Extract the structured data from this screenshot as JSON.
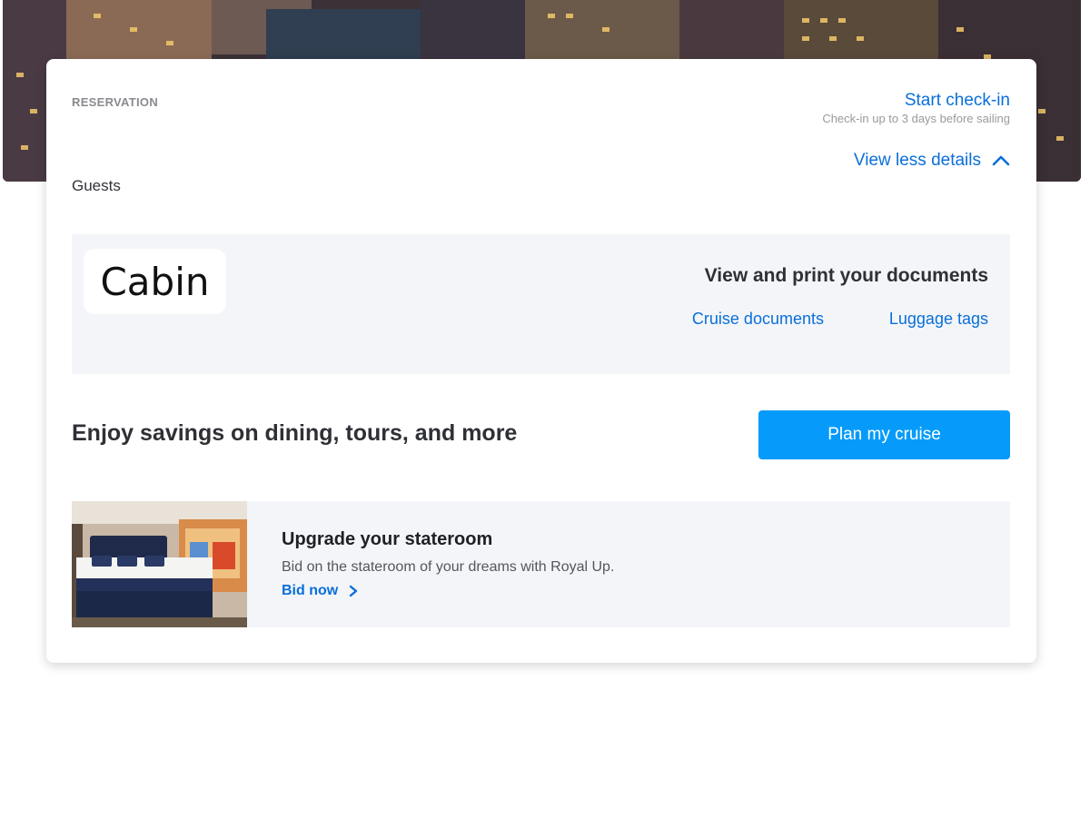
{
  "hero": {
    "image": "city-skyline-night"
  },
  "reservation": {
    "label": "RESERVATION",
    "checkin_link": "Start check-in",
    "checkin_note": "Check-in up to 3 days before sailing",
    "view_less": "View less details",
    "view_less_icon": "chevron-up-icon",
    "guests_label": "Guests"
  },
  "documents": {
    "cabin_label": "Cabin",
    "title": "View and print your documents",
    "cruise_documents": "Cruise documents",
    "luggage_tags": "Luggage tags"
  },
  "promo": {
    "text": "Enjoy savings on dining, tours, and more",
    "button": "Plan my cruise"
  },
  "upgrade": {
    "image": "stateroom-bed-photo",
    "title": "Upgrade your stateroom",
    "description": "Bid on the stateroom of your dreams with Royal Up.",
    "link": "Bid now",
    "link_icon": "chevron-right-icon"
  },
  "colors": {
    "link": "#0a6fd8",
    "button": "#069bfa",
    "panel": "#f3f5f9",
    "text_dark": "#2f3035"
  }
}
